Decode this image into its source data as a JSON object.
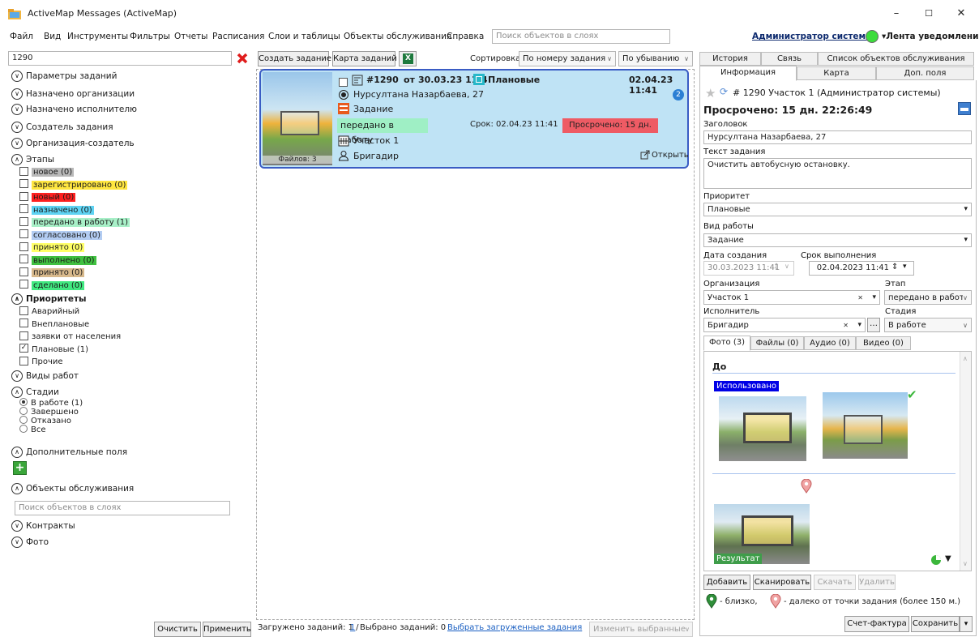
{
  "window": {
    "title": "ActiveMap Messages (ActiveMap)",
    "minimize": "–",
    "maximize": "☐",
    "close": "✕"
  },
  "menu": {
    "items": [
      "Файл",
      "Вид",
      "Инструменты",
      "Фильтры",
      "Отчеты",
      "Расписания",
      "Слои и таблицы",
      "Объекты обслуживания",
      "Справка"
    ],
    "search_placeholder": "Поиск объектов в слоях",
    "user": "Администратор системы",
    "feed": "▾Лента уведомлений"
  },
  "left": {
    "search_value": "1290",
    "sections": {
      "task_params": "Параметры заданий",
      "assigned_org": "Назначено организации",
      "assigned_exec": "Назначено исполнителю",
      "creator": "Создатель задания",
      "creator_org": "Организация-создатель",
      "stages": "Этапы",
      "priorities": "Приоритеты",
      "work_types": "Виды работ",
      "phases": "Стадии",
      "extra_fields": "Дополнительные поля",
      "service_objects": "Объекты обслуживания",
      "contracts": "Контракты",
      "photo": "Фото"
    },
    "stages": [
      {
        "label": "новое (0)",
        "color": "#b9b9b9"
      },
      {
        "label": "зарегистрировано (0)",
        "color": "#ffe640"
      },
      {
        "label": "новый (0)",
        "color": "#ff2020"
      },
      {
        "label": "назначено (0)",
        "color": "#5ed3f3"
      },
      {
        "label": "передано в работу (1)",
        "color": "#a8f0c8"
      },
      {
        "label": "согласовано (0)",
        "color": "#b2ccf2"
      },
      {
        "label": "принято (0)",
        "color": "#ffff66"
      },
      {
        "label": "выполнено (0)",
        "color": "#40c040"
      },
      {
        "label": "принято (0)",
        "color": "#d8b98c"
      },
      {
        "label": "сделано (0)",
        "color": "#40e880"
      }
    ],
    "priorities": [
      {
        "label": "Аварийный",
        "checked": false
      },
      {
        "label": "Внеплановые",
        "checked": false
      },
      {
        "label": "заявки от населения",
        "checked": false
      },
      {
        "label": "Плановые (1)",
        "checked": true
      },
      {
        "label": "Прочие",
        "checked": false
      }
    ],
    "phases": [
      {
        "label": "В работе (1)",
        "selected": true
      },
      {
        "label": "Завершено",
        "selected": false
      },
      {
        "label": "Отказано",
        "selected": false
      },
      {
        "label": "Все",
        "selected": false
      }
    ],
    "objects_search_placeholder": "Поиск объектов в слоях",
    "clear_button": "Очистить",
    "apply_button": "Применить"
  },
  "center": {
    "create_button": "Создать задание",
    "map_button": "Карта заданий",
    "sort_label": "Сортировка",
    "sort_value": "По номеру задания",
    "order_value": "По убыванию",
    "card": {
      "number": "#1290",
      "from": "от",
      "created": "30.03.23 11:4",
      "priority": "Плановые",
      "date": "02.04.23 11:41",
      "address": "Нурсултана Назарбаева, 27",
      "badge": "2",
      "work_type": "Задание",
      "stage": "передано в работу",
      "deadline": "Срок: 02.04.23 11:41",
      "overdue": "Просрочено: 15 дн.",
      "org": "Участок 1",
      "executor": "Бригадир",
      "open": "Открыть",
      "files": "Файлов: 3"
    },
    "status": {
      "loaded": "Загружено заданий: 1 /",
      "loaded_link": "1",
      "selected": "Выбрано заданий: 0",
      "select_all": "Выбрать загруженные задания",
      "change_selected": "Изменить выбранные"
    }
  },
  "right": {
    "tabs_row1": [
      "История",
      "Связь",
      "Список объектов обслуживания"
    ],
    "tabs_row2": [
      "Информация",
      "Карта",
      "Доп. поля"
    ],
    "header": "# 1290  Участок 1 (Администратор системы)",
    "overdue": "Просрочено: 15 дн. 22:26:49",
    "title_label": "Заголовок",
    "title_value": "Нурсултана Назарбаева, 27",
    "text_label": "Текст задания",
    "text_value": "Очистить автобусную остановку.",
    "priority_label": "Приоритет",
    "priority_value": "Плановые",
    "worktype_label": "Вид работы",
    "worktype_value": "Задание",
    "created_label": "Дата создания",
    "created_value": "30.03.2023 11:41",
    "deadline_label": "Срок выполнения",
    "deadline_value": "02.04.2023 11:41",
    "org_label": "Организация",
    "org_value": "Участок 1",
    "stage_label": "Этап",
    "stage_value": "передано в работ",
    "exec_label": "Исполнитель",
    "exec_value": "Бригадир",
    "phase_label": "Стадия",
    "phase_value": "В работе",
    "media_tabs": [
      "Фото (3)",
      "Файлы (0)",
      "Аудио (0)",
      "Видео (0)"
    ],
    "photos": {
      "before": "До",
      "used": "Использовано",
      "result": "Результат"
    },
    "buttons": {
      "add": "Добавить",
      "scan": "Сканировать",
      "download": "Скачать",
      "delete": "Удалить"
    },
    "legend": {
      "near": "- близко,",
      "far": "- далеко от точки задания (более 150 м.)"
    },
    "invoice_button": "Счет-фактура",
    "save_button": "Сохранить"
  }
}
